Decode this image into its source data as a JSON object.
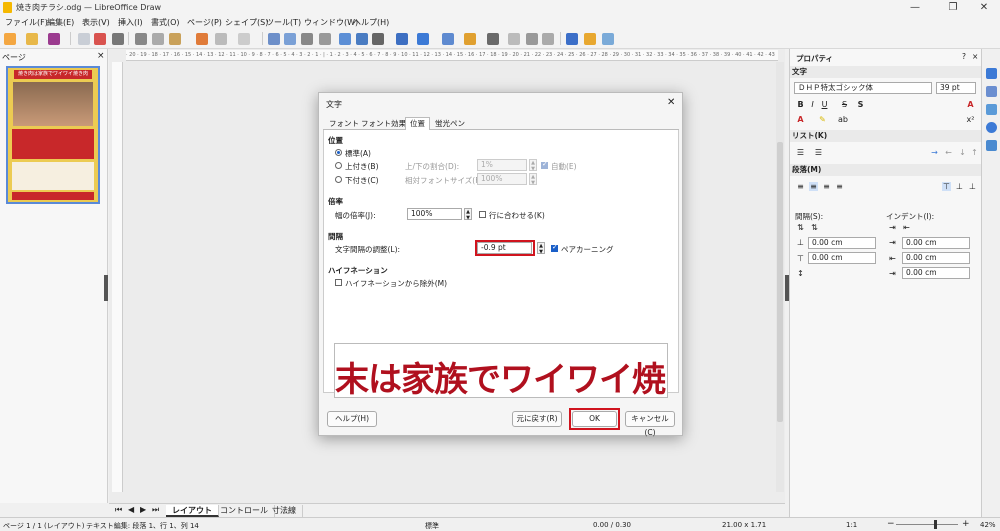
{
  "window": {
    "title": "焼き肉チラシ.odg — LibreOffice Draw",
    "minimize": "—",
    "maximize": "❐",
    "close": "✕"
  },
  "menu": [
    "ファイル(F)",
    "編集(E)",
    "表示(V)",
    "挿入(I)",
    "書式(O)",
    "ページ(P)",
    "シェイプ(S)",
    "ツール(T)",
    "ウィンドウ(W)",
    "ヘルプ(H)"
  ],
  "pages_pane": {
    "title": "ページ",
    "thumb_title": "焼き肉は家族でワイワイ焼き肉"
  },
  "canvas_tabs": {
    "tabs": [
      "レイアウト",
      "コントロール",
      "寸法線"
    ]
  },
  "ruler_text": "· 20 · 19 · 18 · 17 · 16 · 15 · 14 · 13 · 12 · 11 · 10 · 9 · 8 · 7 · 6 · 5 · 4 · 3 · 2 · 1 · | · 1 · 2 · 3 · 4 · 5 · 6 · 7 · 8 · 9 · 10 · 11 · 12 · 13 · 14 · 15 · 16 · 17 · 18 · 19 · 20 · 21 · 22 · 23 · 24 · 25 · 26 · 27 · 28 · 29 · 30 · 31 · 32 · 33 · 34 · 35 · 36 · 37 · 38 · 39 · 40 · 41 · 42 · 43",
  "status": {
    "page": "ページ 1 / 1 (レイアウト)",
    "edit": "テキスト編集: 段落 1、行 1、列 14",
    "style": "標準",
    "position": "0.00 / 0.30",
    "size": "21.00 x 1.71",
    "scale": "1:1",
    "zoom": "42%"
  },
  "sidebar": {
    "title": "プロパティ",
    "char_section": "文字",
    "font_name": "ＤＨＰ特太ゴシック体",
    "font_size": "39 pt",
    "list_section": "リスト(K)",
    "para_section": "段落(M)",
    "spacing_label": "間隔(S):",
    "indent_label": "インデント(I):",
    "spacing_values": [
      "0.00 cm",
      "0.00 cm"
    ],
    "indent_values": [
      "0.00 cm",
      "0.00 cm",
      "0.00 cm"
    ]
  },
  "dialog": {
    "title": "文字",
    "tabs": [
      "フォント",
      "フォント効果",
      "位置",
      "蛍光ペン"
    ],
    "active_tab": 2,
    "position_section": "位置",
    "radio_normal": "標準(A)",
    "radio_super": "上付き(B)",
    "radio_sub": "下付き(C)",
    "raise_label": "上/下の割合(D):",
    "raise_value": "1%",
    "auto_label": "自動(E)",
    "relsize_label": "相対フォントサイズ(F):",
    "relsize_value": "100%",
    "scale_section": "倍率",
    "width_label": "幅の倍率(J):",
    "width_value": "100%",
    "fitline_label": "行に合わせる(K)",
    "spacing_section": "間隔",
    "charspacing_label": "文字間隔の調整(L):",
    "charspacing_value": "-0.9 pt",
    "pairkerning_label": "ペアカーニング",
    "hyphen_section": "ハイフネーション",
    "nohyphen_label": "ハイフネーションから除外(M)",
    "preview_text": "末は家族でワイワイ焼き",
    "help_button": "ヘルプ(H)",
    "reset_button": "元に戻す(R)",
    "ok_button": "OK",
    "cancel_button": "キャンセル(C)"
  },
  "colors": {
    "highlight_red": "#d0141e",
    "accent_blue": "#1a5fc8",
    "preview_red": "#b0101e"
  }
}
